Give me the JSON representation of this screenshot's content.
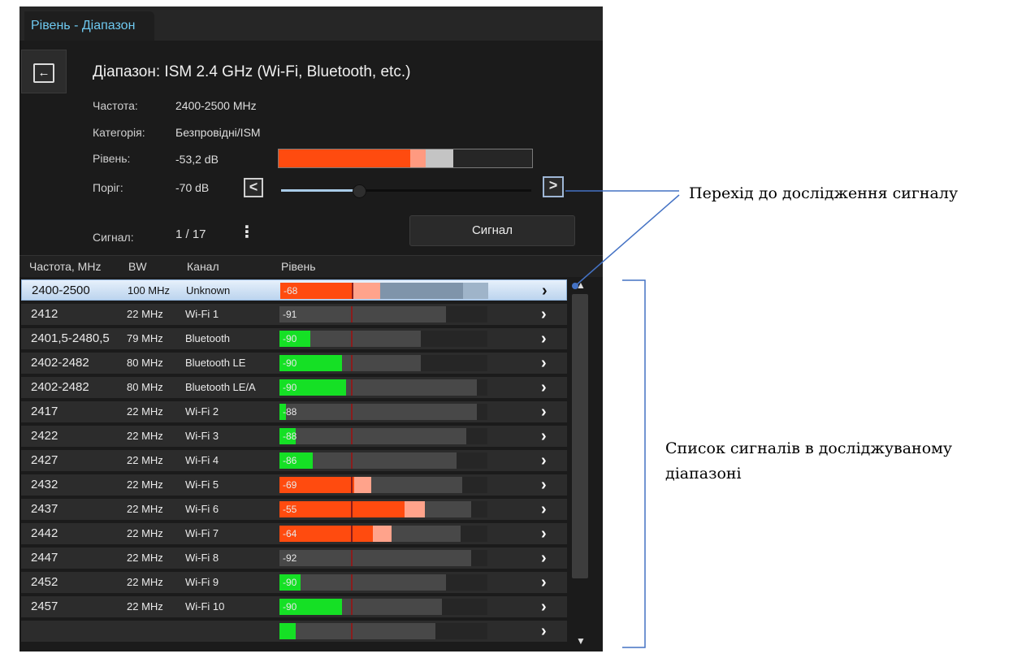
{
  "tab": {
    "label": "Рівень - Діапазон"
  },
  "range": {
    "title": "Діапазон: ISM 2.4 GHz (Wi-Fi, Bluetooth, etc.)"
  },
  "info": {
    "freq_label": "Частота:",
    "freq_value": "2400-2500 MHz",
    "cat_label": "Категорія:",
    "cat_value": "Безпровідні/ISM",
    "level_label": "Рівень:",
    "level_value": "-53,2 dB",
    "threshold_label": "Поріг:",
    "threshold_value": "-70 dB",
    "signal_label": "Сигнал:",
    "signal_value": "1 / 17"
  },
  "level_bar": {
    "fill_fraction": 0.52,
    "peak_fraction": 0.58,
    "ghost_fraction": 0.69
  },
  "threshold_slider": {
    "fraction": 0.31
  },
  "buttons": {
    "signal": "Сигнал",
    "prev": "<",
    "next": ">",
    "back": "←",
    "kebab": "⋮"
  },
  "columns": {
    "freq": "Частота, MHz",
    "bw": "BW",
    "channel": "Канал",
    "level": "Рівень"
  },
  "rows": [
    {
      "freq": "2400-2500",
      "bw": "100 MHz",
      "channel": "Unknown",
      "level": "-68",
      "color": "#ff4b0f",
      "fill": 0.35,
      "peak": 0.48,
      "track": 0.88,
      "selected": true
    },
    {
      "freq": "2412",
      "bw": "22 MHz",
      "channel": "Wi-Fi 1",
      "level": "-91",
      "color": "#ff4b0f",
      "fill": 0.0,
      "peak": 0.0,
      "track": 0.8,
      "selected": false
    },
    {
      "freq": "2401,5-2480,5",
      "bw": "79 MHz",
      "channel": "Bluetooth",
      "level": "-90",
      "color": "#15e025",
      "fill": 0.15,
      "peak": 0.0,
      "track": 0.68,
      "selected": false
    },
    {
      "freq": "2402-2482",
      "bw": "80 MHz",
      "channel": "Bluetooth LE",
      "level": "-90",
      "color": "#15e025",
      "fill": 0.3,
      "peak": 0.0,
      "track": 0.68,
      "selected": false
    },
    {
      "freq": "2402-2482",
      "bw": "80 MHz",
      "channel": "Bluetooth LE/A",
      "level": "-90",
      "color": "#15e025",
      "fill": 0.32,
      "peak": 0.0,
      "track": 0.95,
      "selected": false
    },
    {
      "freq": "2417",
      "bw": "22 MHz",
      "channel": "Wi-Fi 2",
      "level": "-88",
      "color": "#15e025",
      "fill": 0.03,
      "peak": 0.0,
      "track": 0.95,
      "selected": false
    },
    {
      "freq": "2422",
      "bw": "22 MHz",
      "channel": "Wi-Fi 3",
      "level": "-88",
      "color": "#15e025",
      "fill": 0.08,
      "peak": 0.0,
      "track": 0.9,
      "selected": false
    },
    {
      "freq": "2427",
      "bw": "22 MHz",
      "channel": "Wi-Fi 4",
      "level": "-86",
      "color": "#15e025",
      "fill": 0.16,
      "peak": 0.0,
      "track": 0.85,
      "selected": false
    },
    {
      "freq": "2432",
      "bw": "22 MHz",
      "channel": "Wi-Fi 5",
      "level": "-69",
      "color": "#ff4b0f",
      "fill": 0.36,
      "peak": 0.44,
      "track": 0.88,
      "selected": false
    },
    {
      "freq": "2437",
      "bw": "22 MHz",
      "channel": "Wi-Fi 6",
      "level": "-55",
      "color": "#ff4b0f",
      "fill": 0.6,
      "peak": 0.7,
      "track": 0.92,
      "selected": false
    },
    {
      "freq": "2442",
      "bw": "22 MHz",
      "channel": "Wi-Fi 7",
      "level": "-64",
      "color": "#ff4b0f",
      "fill": 0.45,
      "peak": 0.54,
      "track": 0.87,
      "selected": false
    },
    {
      "freq": "2447",
      "bw": "22 MHz",
      "channel": "Wi-Fi 8",
      "level": "-92",
      "color": "#ff4b0f",
      "fill": 0.0,
      "peak": 0.0,
      "track": 0.92,
      "selected": false
    },
    {
      "freq": "2452",
      "bw": "22 MHz",
      "channel": "Wi-Fi 9",
      "level": "-90",
      "color": "#15e025",
      "fill": 0.1,
      "peak": 0.0,
      "track": 0.8,
      "selected": false
    },
    {
      "freq": "2457",
      "bw": "22 MHz",
      "channel": "Wi-Fi 10",
      "level": "-90",
      "color": "#15e025",
      "fill": 0.3,
      "peak": 0.0,
      "track": 0.78,
      "selected": false
    },
    {
      "freq": "",
      "bw": "",
      "channel": "",
      "level": "",
      "color": "#15e025",
      "fill": 0.08,
      "peak": 0.0,
      "track": 0.75,
      "selected": false
    }
  ],
  "annotations": {
    "signal_jump": "Перехід до дослідження сигналу",
    "signal_list_line1": "Список сигналів в досліджуваному",
    "signal_list_line2": "діапазоні"
  }
}
